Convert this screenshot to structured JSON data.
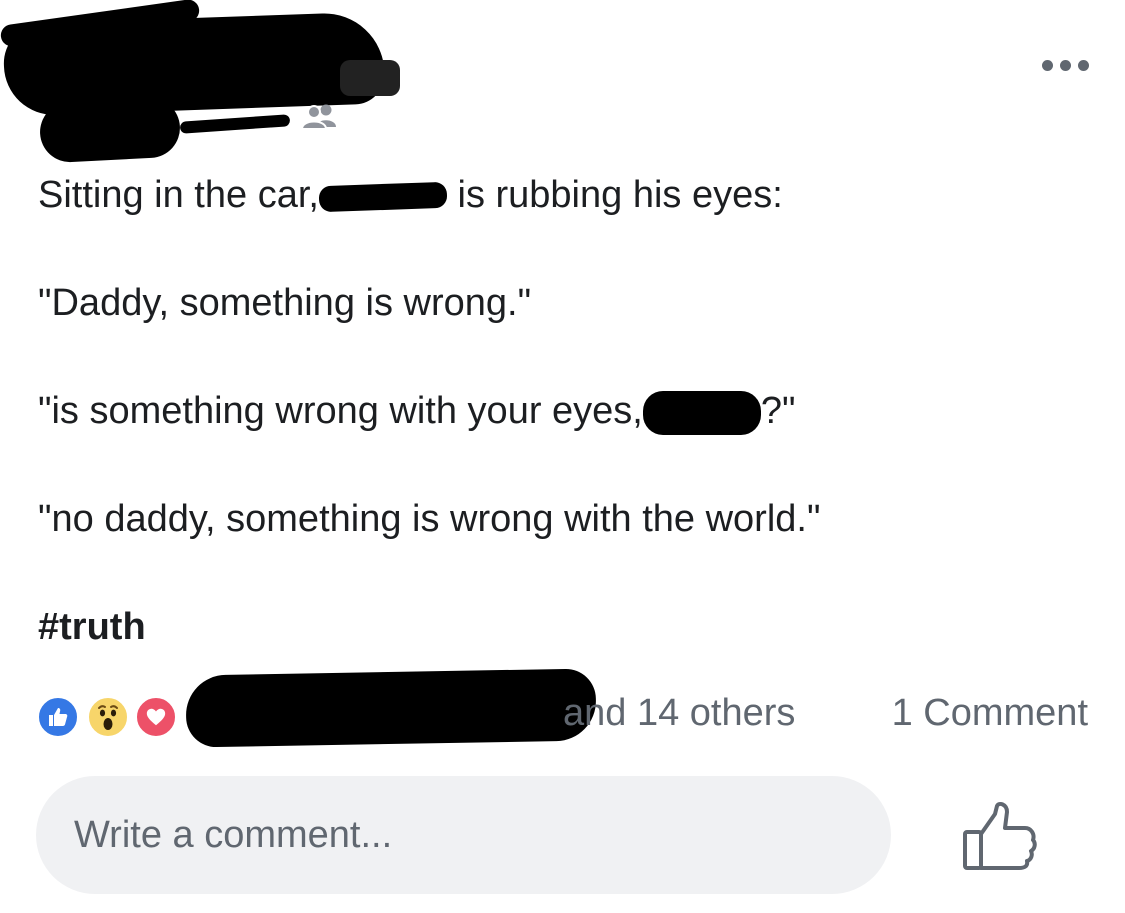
{
  "header": {
    "more_icon": "more-horizontal-icon",
    "audience_icon": "friends-audience-icon"
  },
  "post": {
    "line1_before": "Sitting in the car,",
    "line1_after": " is rubbing his eyes:",
    "line2": "\"Daddy, something is wrong.\"",
    "line3_before": "\"is something wrong with your eyes,",
    "line3_after": "?\"",
    "line4": "\"no daddy, something is wrong with the world.\"",
    "hashtag": "#truth"
  },
  "reactions": {
    "icons": [
      "like-reaction-icon",
      "wow-reaction-icon",
      "love-reaction-icon"
    ],
    "summary": "and 14 others",
    "comment_count": "1 Comment"
  },
  "comment": {
    "placeholder": "Write a comment..."
  },
  "actions": {
    "like_icon": "thumbs-up-outline-icon"
  },
  "colors": {
    "like_blue": "#3578e5",
    "wow_yellow": "#f7d56a",
    "love_red": "#ed5168",
    "secondary_text": "#606770",
    "comment_bg": "#f0f1f3"
  }
}
